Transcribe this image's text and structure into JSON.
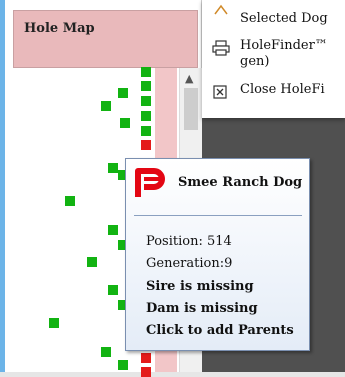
{
  "panel": {
    "title": "Hole Map"
  },
  "menu": {
    "item_selected": "Selected Dog",
    "item_holefinder_line1": "HoleFinder™",
    "item_holefinder_line2": "gen)",
    "item_close": "Close HoleFi"
  },
  "tooltip": {
    "title": "Smee Ranch Dog",
    "position": "Position: 514",
    "generation": "Generation:9",
    "sire": "Sire is missing",
    "dam": "Dam is missing",
    "action": "Click to add Parents"
  },
  "colors": {
    "header_bg": "#e9b9bb",
    "node_green": "#12b312",
    "node_red": "#e41b1b",
    "logo_red": "#e30613"
  },
  "icons": [
    "scroll-up-icon",
    "selected-dog-icon",
    "printer-icon",
    "close-box-icon",
    "pedigree-logo-icon"
  ]
}
